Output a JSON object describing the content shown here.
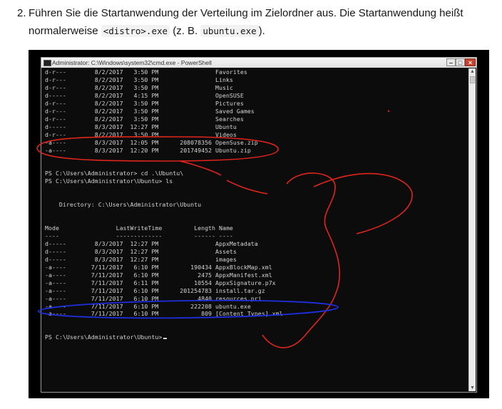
{
  "instruction": {
    "number": "2.",
    "text_before": "Führen Sie die Startanwendung der Verteilung im Zielordner aus. Die Startanwendung heißt normalerweise ",
    "code1": "<distro>.exe",
    "text_mid": " (z. B. ",
    "code2": "ubuntu.exe",
    "text_after": ")."
  },
  "window": {
    "title": "Administrator: C:\\Windows\\system32\\cmd.exe - PowerShell",
    "min_label": "–",
    "max_label": "□",
    "close_label": "×",
    "scroll_up": "▲",
    "scroll_down": "▼"
  },
  "console_lines": [
    "d-r---        8/2/2017   3:50 PM                Favorites",
    "d-r---        8/2/2017   3:50 PM                Links",
    "d-r---        8/2/2017   3:50 PM                Music",
    "d-----        8/2/2017   4:15 PM                OpenSUSE",
    "d-r---        8/2/2017   3:50 PM                Pictures",
    "d-r---        8/2/2017   3:50 PM                Saved Games",
    "d-r---        8/2/2017   3:50 PM                Searches",
    "d-----        8/3/2017  12:27 PM                Ubuntu",
    "d-r---        8/2/2017   3:50 PM                Videos",
    "-a----        8/3/2017  12:05 PM      208078356 OpenSuse.zip",
    "-a----        8/3/2017  12:20 PM      201749452 Ubuntu.zip",
    "",
    "",
    "PS C:\\Users\\Administrator> cd .\\Ubuntu\\",
    "PS C:\\Users\\Administrator\\Ubuntu> ls",
    "",
    "",
    "    Directory: C:\\Users\\Administrator\\Ubuntu",
    "",
    "",
    "Mode                LastWriteTime         Length Name",
    "----                -------------         ------ ----",
    "d-----        8/3/2017  12:27 PM                AppxMetadata",
    "d-----        8/3/2017  12:27 PM                Assets",
    "d-----        8/3/2017  12:27 PM                images",
    "-a----       7/11/2017   6:10 PM         190434 AppxBlockMap.xml",
    "-a----       7/11/2017   6:10 PM           2475 AppxManifest.xml",
    "-a----       7/11/2017   6:11 PM          10554 AppxSignature.p7x",
    "-a----       7/11/2017   6:10 PM      201254783 install.tar.gz",
    "-a----       7/11/2017   6:10 PM           4840 resources.pri",
    "-a----       7/11/2017   6:10 PM         222208 ubuntu.exe",
    "-a----       7/11/2017   6:10 PM            809 [Content_Types].xml",
    "",
    "",
    "PS C:\\Users\\Administrator\\Ubuntu>"
  ],
  "colors": {
    "annotation_red": "#e0251b",
    "annotation_blue": "#1f2fe0",
    "console_bg": "#0c0c0c",
    "console_text": "#d4d4d4"
  }
}
